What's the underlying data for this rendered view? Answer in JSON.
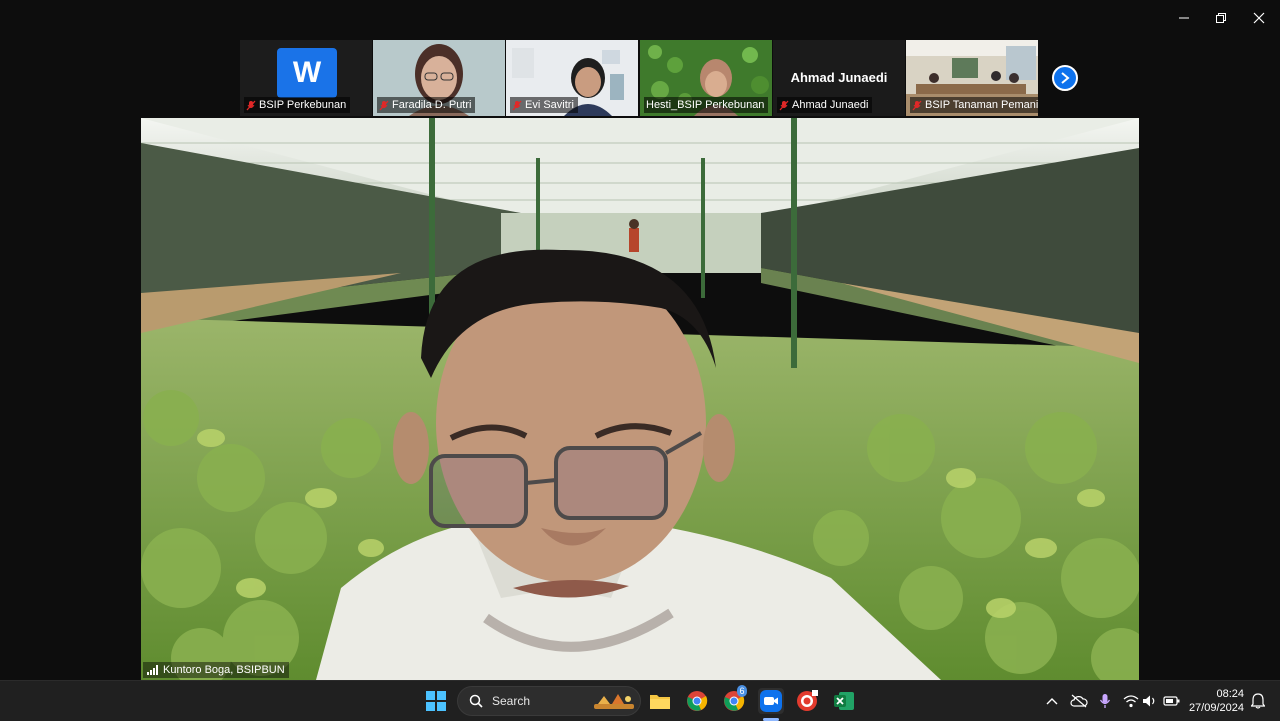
{
  "window": {
    "controls": [
      "minimize",
      "restore",
      "close"
    ]
  },
  "participants": [
    {
      "name": "BSIP Perkebunan",
      "avatar_letter": "W",
      "muted": true
    },
    {
      "name": "Faradila D. Putri",
      "muted": true
    },
    {
      "name": "Evi Savitri",
      "muted": true
    },
    {
      "name": "Hesti_BSIP Perkebunan",
      "muted": false
    },
    {
      "name": "Ahmad Junaedi",
      "display_name": "Ahmad Junaedi",
      "muted": true
    },
    {
      "name": "BSIP Tanaman Pemanis...",
      "muted": true
    }
  ],
  "speaker": {
    "name": "Kuntoro Boga, BSIPBUN"
  },
  "taskbar": {
    "search_label": "Search",
    "chrome_badge": "6",
    "time": "08:24",
    "date": "27/09/2024"
  },
  "colors": {
    "zoom_blue": "#0e72ed",
    "muted_red": "#e02828"
  }
}
